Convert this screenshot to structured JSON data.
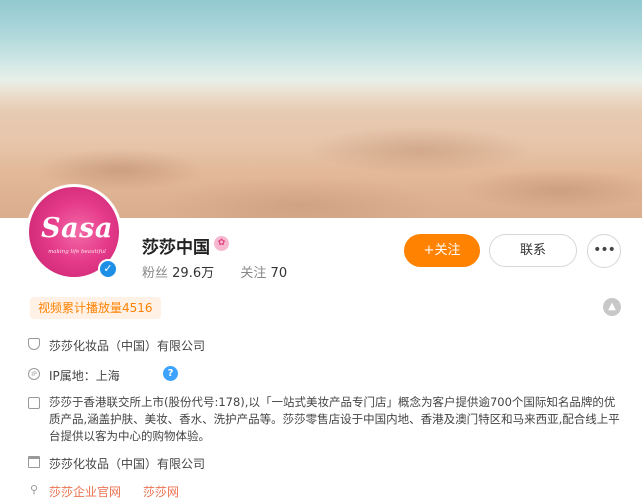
{
  "profile": {
    "name": "莎莎中国",
    "avatar_text": "Sasa",
    "avatar_tagline": "making life beautiful",
    "verified_icon": "check-icon",
    "followers_label": "粉丝",
    "followers_value": "29.6万",
    "following_label": "关注",
    "following_value": "70"
  },
  "actions": {
    "follow_label": "+关注",
    "contact_label": "联系",
    "more_label": "•••"
  },
  "badges": {
    "views_label": "视频累计播放量4516"
  },
  "info": {
    "company": "莎莎化妆品（中国）有限公司",
    "ip_location": "IP属地：上海",
    "description": "莎莎于香港联交所上市(股份代号:178),以「一站式美妆产品专门店」概念为客户提供逾700个国际知名品牌的优质产品,涵盖护肤、美妆、香水、洗护产品等。莎莎零售店设于中国内地、香港及澳门特区和马来西亚,配合线上平台提供以客为中心的购物体验。",
    "store_name": "莎莎化妆品（中国）有限公司",
    "links": [
      "莎莎企业官网",
      "莎莎网"
    ]
  },
  "colors": {
    "accent": "#ff8200",
    "link": "#eb7350",
    "verified": "#1d8fe6",
    "brand_pink": "#e53a8a"
  }
}
